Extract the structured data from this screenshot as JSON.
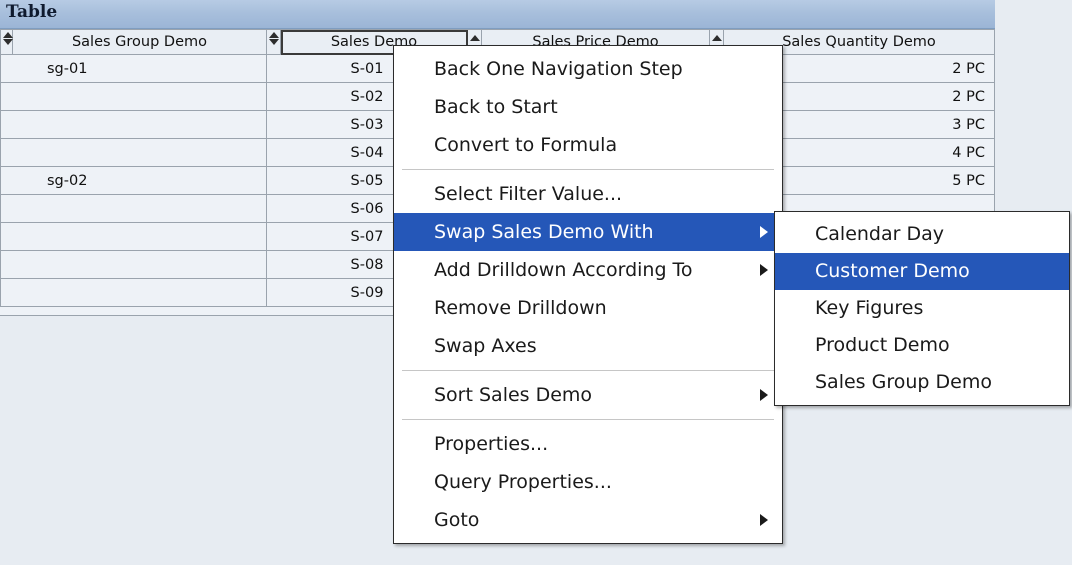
{
  "window": {
    "title": "Table"
  },
  "table": {
    "columns": [
      {
        "header": "Sales Group Demo",
        "align": "left",
        "selected": false,
        "sorter": "double"
      },
      {
        "header": "Sales Demo",
        "align": "center",
        "selected": true,
        "sorter": "double"
      },
      {
        "header": "Sales Price Demo",
        "align": "center",
        "selected": false,
        "sorter": "single"
      },
      {
        "header": "Sales Quantity Demo",
        "align": "right",
        "selected": false,
        "sorter": "single"
      }
    ],
    "rows": [
      {
        "sales_group": "sg-01",
        "sales": "S-01",
        "price": "",
        "quantity": "2 PC"
      },
      {
        "sales_group": "",
        "sales": "S-02",
        "price": "",
        "quantity": "2 PC"
      },
      {
        "sales_group": "",
        "sales": "S-03",
        "price": "",
        "quantity": "3 PC"
      },
      {
        "sales_group": "",
        "sales": "S-04",
        "price": "",
        "quantity": "4 PC"
      },
      {
        "sales_group": "sg-02",
        "sales": "S-05",
        "price": "",
        "quantity": "5 PC"
      },
      {
        "sales_group": "",
        "sales": "S-06",
        "price": "",
        "quantity": ""
      },
      {
        "sales_group": "",
        "sales": "S-07",
        "price": "",
        "quantity": ""
      },
      {
        "sales_group": "",
        "sales": "S-08",
        "price": "",
        "quantity": ""
      },
      {
        "sales_group": "",
        "sales": "S-09",
        "price": "",
        "quantity": ""
      }
    ]
  },
  "context_menu": {
    "items": [
      {
        "label": "Back One Navigation Step",
        "submenu": false,
        "highlight": false
      },
      {
        "label": "Back to Start",
        "submenu": false,
        "highlight": false
      },
      {
        "label": "Convert to Formula",
        "submenu": false,
        "highlight": false
      },
      {
        "separator": true
      },
      {
        "label": "Select Filter Value...",
        "submenu": false,
        "highlight": false
      },
      {
        "label": "Swap Sales Demo With",
        "submenu": true,
        "highlight": true
      },
      {
        "label": "Add Drilldown According To",
        "submenu": true,
        "highlight": false
      },
      {
        "label": "Remove Drilldown",
        "submenu": false,
        "highlight": false
      },
      {
        "label": "Swap Axes",
        "submenu": false,
        "highlight": false
      },
      {
        "separator": true
      },
      {
        "label": "Sort Sales Demo",
        "submenu": true,
        "highlight": false
      },
      {
        "separator": true
      },
      {
        "label": "Properties...",
        "submenu": false,
        "highlight": false
      },
      {
        "label": "Query Properties...",
        "submenu": false,
        "highlight": false
      },
      {
        "label": "Goto",
        "submenu": true,
        "highlight": false
      }
    ]
  },
  "sub_menu": {
    "items": [
      {
        "label": "Calendar Day",
        "highlight": false
      },
      {
        "label": "Customer Demo",
        "highlight": true
      },
      {
        "label": "Key Figures",
        "highlight": false
      },
      {
        "label": "Product Demo",
        "highlight": false
      },
      {
        "label": "Sales Group Demo",
        "highlight": false
      }
    ]
  },
  "colors": {
    "title_bar": "#a8bfdc",
    "page_background": "#e7ecf2",
    "row_background": "#eef2f7",
    "grid_line": "#9aa3ad",
    "menu_highlight": "#2557b8",
    "menu_background": "#ffffff"
  }
}
